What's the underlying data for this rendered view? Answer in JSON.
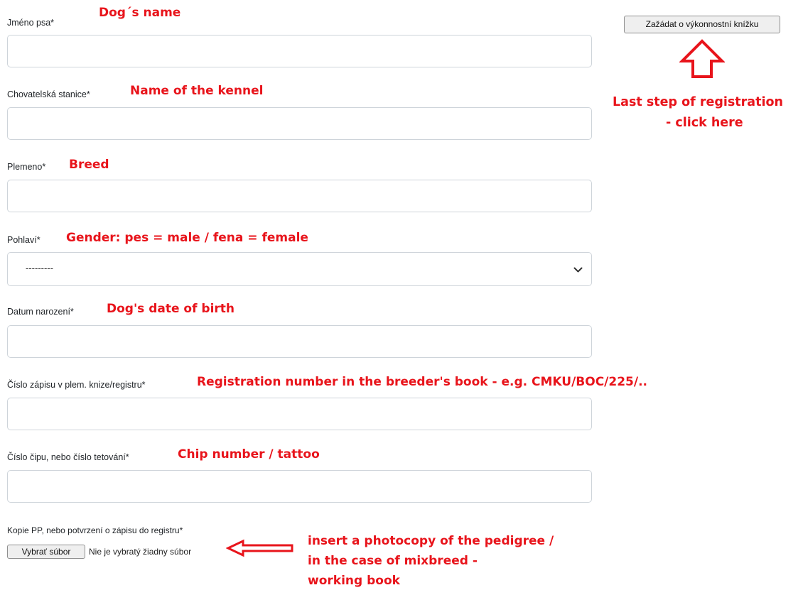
{
  "form": {
    "fields": [
      {
        "label": "Jméno psa*",
        "annotation": "Dog´s name",
        "value": ""
      },
      {
        "label": "Chovatelská stanice*",
        "annotation": "Name of the kennel",
        "value": ""
      },
      {
        "label": "Plemeno*",
        "annotation": "Breed",
        "value": ""
      },
      {
        "label": "Pohlaví*",
        "annotation": "Gender: pes = male / fena = female",
        "selected": "---------"
      },
      {
        "label": "Datum narození*",
        "annotation": "Dog's date of birth",
        "value": ""
      },
      {
        "label": "Číslo zápisu v plem. knize/registru*",
        "annotation": "Registration number in the breeder's book - e.g. CMKU/BOC/225/..",
        "value": ""
      },
      {
        "label": "Číslo čipu, nebo číslo tetování*",
        "annotation": "Chip number / tattoo",
        "value": ""
      }
    ],
    "upload": {
      "label": "Kopie PP, nebo potvrzení o zápisu do registru*",
      "button_label": "Vybrať súbor",
      "status": "Nie je vybratý žiadny súbor",
      "annotation_lines": [
        "insert a photocopy of the pedigree /",
        "in the case of mixbreed -",
        "working book"
      ]
    }
  },
  "submit": {
    "label": "Zažádat o výkonnostní knížku",
    "annotation_lines": [
      "Last step of registration",
      "- click here"
    ]
  },
  "colors": {
    "annotation": "#e8141b"
  },
  "icons": {
    "select_arrow": "chevron-down-icon",
    "up_arrow": "up-arrow-icon",
    "left_arrow": "left-arrow-icon"
  }
}
